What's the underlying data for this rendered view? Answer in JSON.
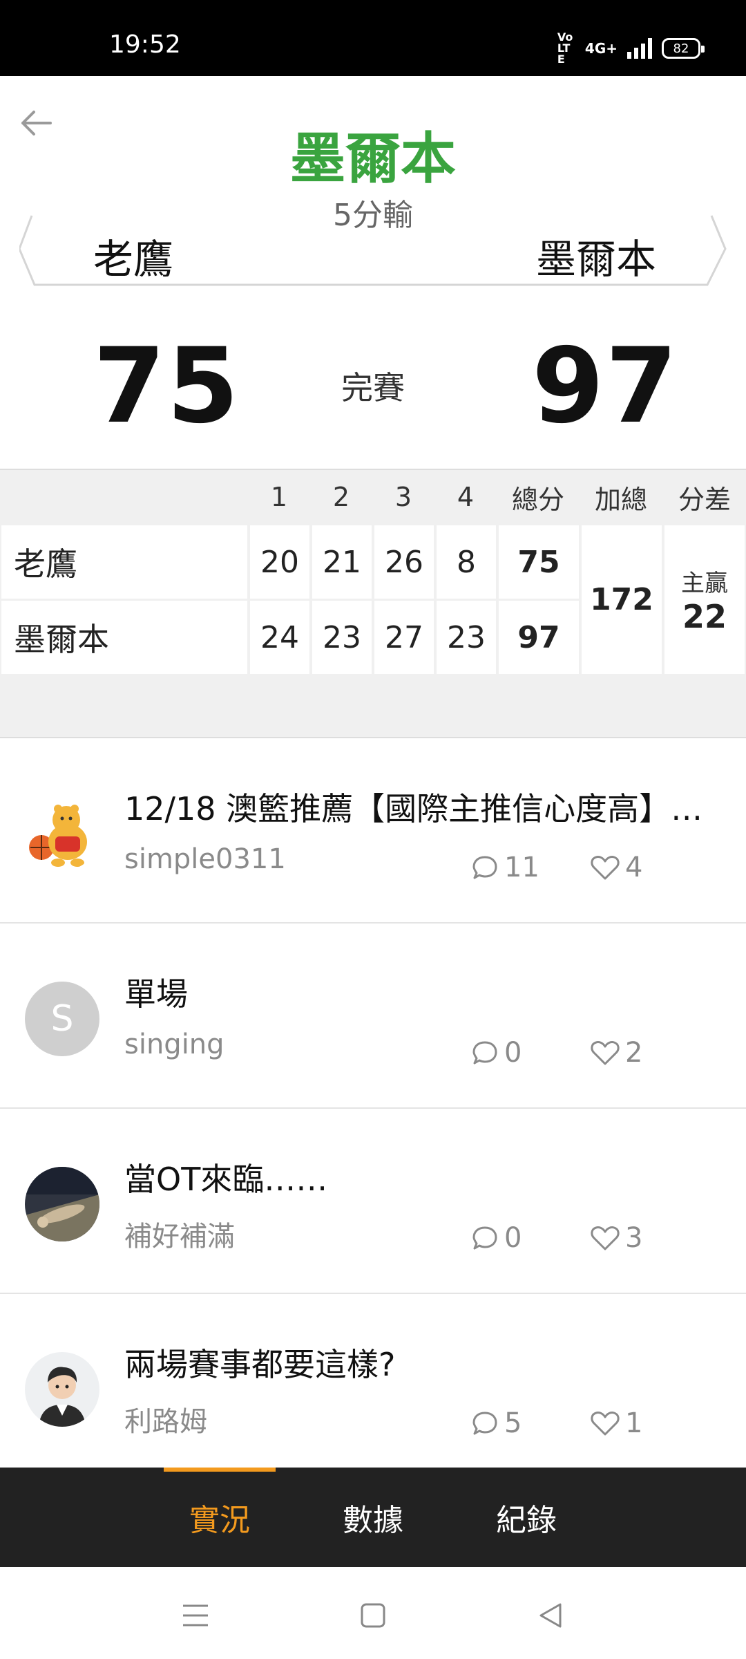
{
  "status_bar": {
    "time": "19:52",
    "volte": "Vo LTE",
    "network": "4G+",
    "battery": "82"
  },
  "header": {
    "winner": "墨爾本",
    "result": "5分輸",
    "back_icon": "arrow-left-icon"
  },
  "teams": {
    "away": "老鷹",
    "home": "墨爾本"
  },
  "score": {
    "away": "75",
    "home": "97",
    "status": "完賽"
  },
  "box_score": {
    "headers": [
      "1",
      "2",
      "3",
      "4",
      "總分",
      "加總",
      "分差"
    ],
    "rows": [
      {
        "team": "老鷹",
        "q": [
          "20",
          "21",
          "26",
          "8"
        ],
        "total": "75"
      },
      {
        "team": "墨爾本",
        "q": [
          "24",
          "23",
          "27",
          "23"
        ],
        "total": "97"
      }
    ],
    "combined": "172",
    "diff_label": "主贏",
    "diff_value": "22"
  },
  "posts": [
    {
      "title": "12/18 澳籃推薦【國際主推信心度高】…",
      "author": "simple0311",
      "comments": "11",
      "likes": "4",
      "avatar": "pooh-basketball-avatar"
    },
    {
      "title": "單場",
      "author": "singing",
      "comments": "0",
      "likes": "2",
      "avatar_letter": "S"
    },
    {
      "title": "當OT來臨……",
      "author": "補好補滿",
      "comments": "0",
      "likes": "3",
      "avatar": "photo-avatar"
    },
    {
      "title": "兩場賽事都要這樣?",
      "author": "利路姆",
      "comments": "5",
      "likes": "1",
      "avatar": "cartoon-person-avatar"
    }
  ],
  "tabs": [
    {
      "label": "實況",
      "active": true
    },
    {
      "label": "數據",
      "active": false
    },
    {
      "label": "紀錄",
      "active": false
    }
  ],
  "colors": {
    "accent": "#f39a1e",
    "winner_green": "#3aa43f",
    "tab_bg": "#222222"
  }
}
